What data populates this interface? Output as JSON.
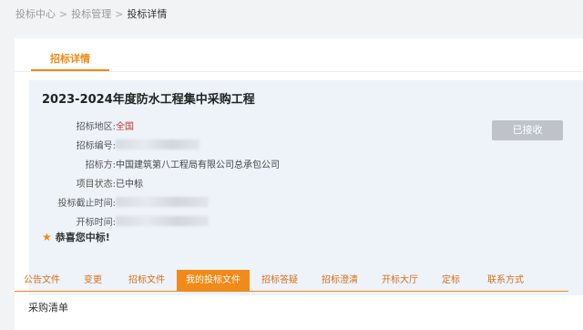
{
  "breadcrumb": {
    "items": [
      "投标中心",
      "投标管理",
      "投标详情"
    ],
    "separator": ">"
  },
  "detail_tab": {
    "label": "招标详情"
  },
  "project": {
    "title": "2023-2024年度防水工程集中采购工程",
    "fields": {
      "region_label": "招标地区:",
      "region_value": "全国",
      "number_label": "招标编号:",
      "tenderer_label": "招标方:",
      "tenderer_value": "中国建筑第八工程局有限公司总承包公司",
      "status_label": "项目状态:",
      "status_value": "已中标",
      "deadline_label": "投标截止时间:",
      "opening_label": "开标时间:"
    },
    "status_button": "已接收",
    "congrats": "恭喜您中标!"
  },
  "tabs": [
    {
      "label": "公告文件",
      "active": false
    },
    {
      "label": "变更",
      "active": false
    },
    {
      "label": "招标文件",
      "active": false
    },
    {
      "label": "我的投标文件",
      "active": true
    },
    {
      "label": "招标答疑",
      "active": false
    },
    {
      "label": "招标澄清",
      "active": false
    },
    {
      "label": "开标大厅",
      "active": false
    },
    {
      "label": "定标",
      "active": false
    },
    {
      "label": "联系方式",
      "active": false
    }
  ],
  "section": {
    "title": "采购清单"
  },
  "colors": {
    "accent": "#f08a19",
    "region_value": "#c0392b",
    "info_bg": "#eef2f9"
  }
}
